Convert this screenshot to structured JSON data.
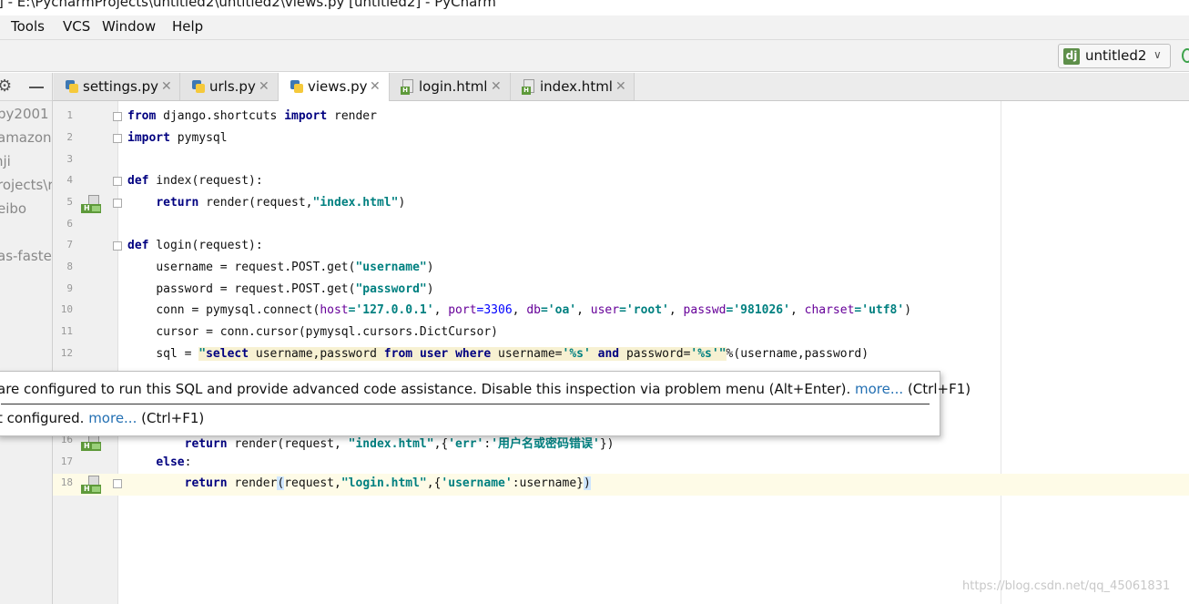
{
  "window": {
    "title": "] - E:\\PycharmProjects\\untitled2\\untitled2\\views.py [untitled2] - PyCharm"
  },
  "menu": {
    "items": [
      "Tools",
      "VCS",
      "Window",
      "Help"
    ]
  },
  "run_config": {
    "badge": "dj",
    "label": "untitled2"
  },
  "project_panel": {
    "items": [
      "py2001",
      "amazon",
      "nji",
      "rojects\\r",
      "eibo",
      "as-faster"
    ]
  },
  "tabs": [
    {
      "label": "settings.py",
      "icon": "python-file-icon"
    },
    {
      "label": "urls.py",
      "icon": "python-file-icon"
    },
    {
      "label": "views.py",
      "icon": "python-file-icon",
      "active": true
    },
    {
      "label": "login.html",
      "icon": "html-file-icon"
    },
    {
      "label": "index.html",
      "icon": "html-file-icon"
    }
  ],
  "editor": {
    "line_numbers": [
      "1",
      "2",
      "3",
      "4",
      "5",
      "6",
      "7",
      "8",
      "9",
      "10",
      "11",
      "12",
      "16",
      "17",
      "18"
    ],
    "lines": {
      "l1": {
        "kw1": "from",
        "t1": " django.shortcuts ",
        "kw2": "import",
        "t2": " render"
      },
      "l2": {
        "kw1": "import",
        "t1": " pymysql"
      },
      "l4": {
        "kw1": "def",
        "t1": " index(request):"
      },
      "l5": {
        "kw1": "return",
        "t1": " render(request,",
        "s1": "\"index.html\"",
        "t2": ")"
      },
      "l7": {
        "kw1": "def",
        "t1": " login(request):"
      },
      "l8": {
        "t1": "username = request.POST.get(",
        "s1": "\"username\"",
        "t2": ")"
      },
      "l9": {
        "t1": "password = request.POST.get(",
        "s1": "\"password\"",
        "t2": ")"
      },
      "l10": {
        "t1": "conn = pymysql.connect(",
        "p1": "host",
        "s1": "='127.0.0.1'",
        "c1": ", ",
        "p2": "port",
        "n1": "=3306",
        "c2": ", ",
        "p3": "db",
        "s2": "='oa'",
        "c3": ", ",
        "p4": "user",
        "s3": "='root'",
        "c4": ", ",
        "p5": "passwd",
        "s4": "='981026'",
        "c5": ", ",
        "p6": "charset",
        "s5": "='utf8'",
        "t2": ")"
      },
      "l11": {
        "t1": "cursor = conn.cursor(pymysql.cursors.DictCursor)"
      },
      "l12": {
        "t1": "sql = ",
        "q1": "\"",
        "k1": "select",
        "t2": " username,password ",
        "k2": "from",
        "t3": " ",
        "k3": "user",
        "t4": " ",
        "k4": "where",
        "t5": " username=",
        "q2": "'%s'",
        "t6": " ",
        "k5": "and",
        "t7": " password=",
        "q3": "'%s'",
        "q4": "\"",
        "t8": "%(username,password)"
      },
      "l16": {
        "kw1": "return",
        "t1": " render(request, ",
        "s1": "\"index.html\"",
        "t2": ",{",
        "s2": "'err'",
        "t3": ":",
        "s3": "'用户名或密码错误'",
        "t4": "})"
      },
      "l17": {
        "kw1": "else",
        "t1": ":"
      },
      "l18": {
        "kw1": "return",
        "t1": " render",
        "b1": "(",
        "t2": "request,",
        "s1": "\"login.html\"",
        "t3": ",{",
        "s2": "'username'",
        "t4": ":username}",
        "b2": ")"
      }
    }
  },
  "tooltip": {
    "line1_text": "are configured to run this SQL and provide advanced code assistance. Disable this inspection via problem menu (Alt+Enter). ",
    "line1_link": "more...",
    "line1_shortcut": " (Ctrl+F1)",
    "line2_text": "t configured. ",
    "line2_link": "more...",
    "line2_shortcut": " (Ctrl+F1)"
  },
  "watermark": "https://blog.csdn.net/qq_45061831"
}
